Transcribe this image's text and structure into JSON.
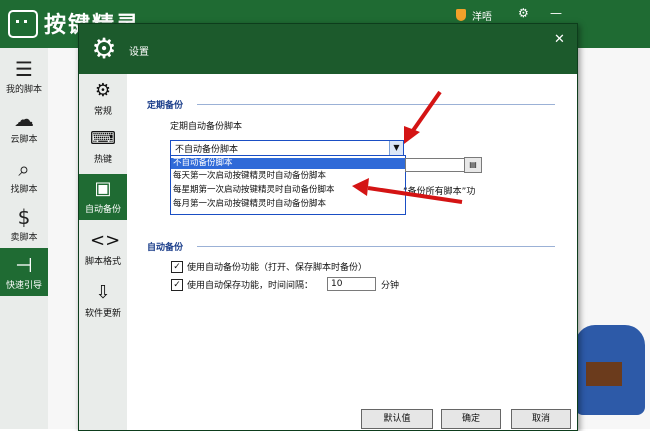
{
  "app": {
    "title": "按键精灵",
    "user_name": "洋唔",
    "sidebar": [
      {
        "label": "我的脚本",
        "icon": "list-icon"
      },
      {
        "label": "云脚本",
        "icon": "cloud-icon"
      },
      {
        "label": "找脚本",
        "icon": "search-icon"
      },
      {
        "label": "卖脚本",
        "icon": "dollar-icon"
      },
      {
        "label": "快速引导",
        "icon": "signpost-icon"
      }
    ]
  },
  "dialog": {
    "title": "设置",
    "nav": [
      {
        "label": "常规",
        "icon": "gear-icon"
      },
      {
        "label": "热键",
        "icon": "keyboard-icon"
      },
      {
        "label": "自动备份",
        "icon": "save-icon"
      },
      {
        "label": "脚本格式",
        "icon": "code-icon"
      },
      {
        "label": "软件更新",
        "icon": "download-icon"
      }
    ],
    "scheduled_backup": {
      "section_title": "定期备份",
      "label": "定期自动备份脚本",
      "selected": "不自动备份脚本",
      "options": [
        "不自动备份脚本",
        "每天第一次启动按键精灵时自动备份脚本",
        "每星期第一次启动按键精灵时自动备份脚本",
        "每月第一次启动按键精灵时自动备份脚本"
      ],
      "hint": "“备份所有脚本”功"
    },
    "auto_backup": {
      "section_title": "自动备份",
      "option1": "使用自动备份功能（打开、保存脚本时备份）",
      "option2": "使用自动保存功能，时间间隔：",
      "interval_value": "10",
      "interval_unit": "分钟"
    },
    "buttons": {
      "default": "默认值",
      "ok": "确定",
      "cancel": "取消"
    }
  },
  "colors": {
    "header_green": "#1f6b33",
    "dialog_title_green": "#1c5a2c",
    "section_blue": "#1a3d8a",
    "selection_blue": "#2f6ad8",
    "arrow_red": "#d41414"
  }
}
